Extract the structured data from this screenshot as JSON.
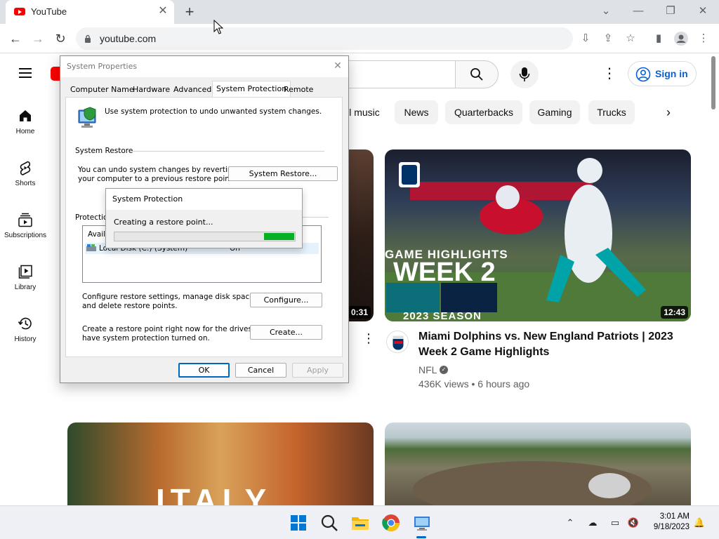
{
  "browser": {
    "tab_title": "YouTube",
    "url": "youtube.com"
  },
  "youtube": {
    "sign_in": "Sign in",
    "sidebar": [
      {
        "label": "Home",
        "icon": "home-icon"
      },
      {
        "label": "Shorts",
        "icon": "shorts-icon"
      },
      {
        "label": "Subscriptions",
        "icon": "subscriptions-icon"
      },
      {
        "label": "Library",
        "icon": "library-icon"
      },
      {
        "label": "History",
        "icon": "history-icon"
      }
    ],
    "chips": [
      "l music",
      "News",
      "Quarterbacks",
      "Gaming",
      "Trucks"
    ],
    "videos": [
      {
        "duration": "0:31"
      },
      {
        "duration": "12:43",
        "thumb_lines": [
          "GAME HIGHLIGHTS",
          "WEEK 2",
          "2023 SEASON"
        ],
        "title": "Miami Dolphins vs. New England Patriots | 2023 Week 2 Game Highlights",
        "channel": "NFL",
        "meta": "436K views • 6 hours ago"
      },
      {
        "thumb_text": "ITALY"
      },
      {}
    ]
  },
  "system_properties": {
    "title": "System Properties",
    "tabs": [
      "Computer Name",
      "Hardware",
      "Advanced",
      "System Protection",
      "Remote"
    ],
    "active_tab": "System Protection",
    "intro": "Use system protection to undo unwanted system changes.",
    "restore_group": "System Restore",
    "restore_text_1": "You can undo system changes by reverting",
    "restore_text_2": "your computer to a previous restore point.",
    "restore_button": "System Restore...",
    "protection_group": "Protection",
    "list_header": "Availa",
    "list_drive": "Local Disk (C:) (System)",
    "list_status": "On",
    "configure_text_1": "Configure restore settings, manage disk space,",
    "configure_text_2": "and delete restore points.",
    "configure_button": "Configure...",
    "create_text_1": "Create a restore point right now for the drives that",
    "create_text_2": "have system protection turned on.",
    "create_button": "Create...",
    "ok": "OK",
    "cancel": "Cancel",
    "apply": "Apply"
  },
  "progress_dialog": {
    "title": "System Protection",
    "message": "Creating a restore point...",
    "progress_fill_start": 0.83,
    "progress_fill_end": 1.0
  },
  "taskbar": {
    "time": "3:01 AM",
    "date": "9/18/2023"
  },
  "colors": {
    "youtube_red": "#ff0000",
    "link_blue": "#065fd4",
    "progress_green": "#06b025"
  }
}
